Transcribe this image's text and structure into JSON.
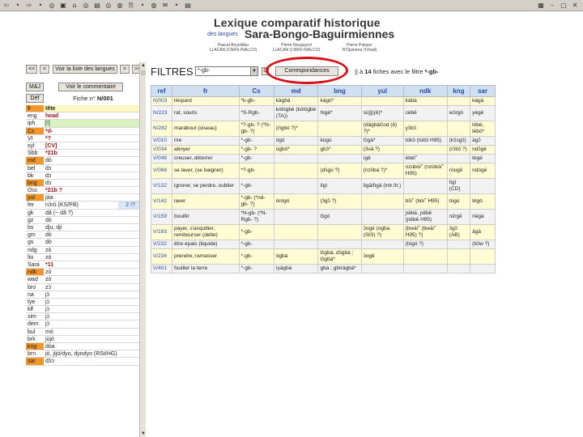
{
  "toolbar": {
    "left_glyphs": [
      "⇦",
      "•",
      "⇨",
      "•",
      "◎",
      "▣",
      "⌂",
      "◎",
      "▤",
      "◎",
      "◍",
      "⎘",
      "•",
      "◍",
      "✉",
      "•",
      "▤"
    ],
    "right_glyphs": [
      "▦",
      "–",
      "▢",
      "✕"
    ]
  },
  "header": {
    "title_line1": "Lexique comparatif historique",
    "title_prefix": "des langues",
    "title_line2": "Sara-Bongo-Baguirmiennes",
    "authors": [
      {
        "name": "Pascal Boyeldieu",
        "affil": "LLACAN (CNRS-INALCO)"
      },
      {
        "name": "Pierre Nougayrol",
        "affil": "LLACAN (CNRS-INALCO)"
      },
      {
        "name": "Pierre Palayer",
        "affil": "N'Djamena (Tchad)"
      }
    ]
  },
  "left": {
    "nav": {
      "first": "<<",
      "prev": "<",
      "list": "Voir la liste des langues",
      "next": ">",
      "last": ">>"
    },
    "msj": "M&J",
    "comment_btn": "Voir le commentaire",
    "def": "Déf",
    "fiche_label": "Fiche n°",
    "fiche_num": "N/001",
    "rows": [
      {
        "code": "fr",
        "value": "tête",
        "style": "orange yellow bold"
      },
      {
        "code": "eng",
        "value": "head",
        "style": "redtxt"
      },
      {
        "code": "iph",
        "value": "[!]",
        "style": "green"
      },
      {
        "code": "Cs",
        "value": "*d-",
        "style": "orange redtxt"
      },
      {
        "code": "VI",
        "value": "*?",
        "style": "redtxt"
      },
      {
        "code": "syl",
        "value": "[CV]",
        "style": "redtxt"
      },
      {
        "code": "Sbb",
        "value": "*21b",
        "style": "redtxt"
      },
      {
        "code": "md",
        "value": "dò",
        "style": "orange"
      },
      {
        "code": "bel",
        "value": "dɔ",
        "style": ""
      },
      {
        "code": "bk",
        "value": "dɔ",
        "style": ""
      },
      {
        "code": "bng",
        "value": "dɔ",
        "style": "orange"
      },
      {
        "code": "Occ",
        "value": "*21b ?",
        "style": "redtxt"
      },
      {
        "code": "yul",
        "value": "jàa",
        "style": "orange"
      },
      {
        "code": "fer",
        "value": "nɔ̀rū (KS/PB)",
        "extra": "2 !?",
        "style": ""
      },
      {
        "code": "gk",
        "value": "dǎ (~ dǎ ?)",
        "style": ""
      },
      {
        "code": "gz",
        "value": "dò",
        "style": ""
      },
      {
        "code": "bs",
        "value": "dju, dji",
        "style": ""
      },
      {
        "code": "gm",
        "value": "dò",
        "style": ""
      },
      {
        "code": "gs",
        "value": "dò",
        "style": ""
      },
      {
        "code": "ndg",
        "value": "zò",
        "style": ""
      },
      {
        "code": "lto",
        "value": "zò",
        "style": ""
      },
      {
        "code": "Sara",
        "value": "*11",
        "style": "redtxt"
      },
      {
        "code": "ndk",
        "value": "zò",
        "style": "orange"
      },
      {
        "code": "wad",
        "value": "zò",
        "style": ""
      },
      {
        "code": "bro",
        "value": "zɔ̀",
        "style": ""
      },
      {
        "code": "na",
        "value": "jɔ̀",
        "style": ""
      },
      {
        "code": "tye",
        "value": "jɔ̀",
        "style": ""
      },
      {
        "code": "klf",
        "value": "jɔ̀",
        "style": ""
      },
      {
        "code": "sim",
        "value": "jɔ̀",
        "style": ""
      },
      {
        "code": "dem",
        "value": "jɔ̀",
        "style": ""
      },
      {
        "code": "bul",
        "value": "mó",
        "style": ""
      },
      {
        "code": "brk",
        "value": "jùjó",
        "style": ""
      },
      {
        "code": "kng",
        "value": "dòa",
        "style": "orange"
      },
      {
        "code": "brn",
        "value": "jò, jìjò/dyo, dyodyo (RSt/HG)",
        "style": ""
      },
      {
        "code": "sar",
        "value": "dɔ̀ɔ",
        "style": "orange"
      }
    ]
  },
  "filter": {
    "label": "FILTRES",
    "select_value": "*-gb-",
    "small_btn": "D",
    "corr_btn": "Correspondances",
    "info_sep": "||",
    "info_prefix": "à",
    "info_count": "14",
    "info_mid": "fiches avec le filtre",
    "info_filter": "*-gb-"
  },
  "table": {
    "headers": [
      "ref",
      "fr",
      "Cs",
      "md",
      "bng",
      "yul",
      "ndk",
      "kng",
      "sar"
    ],
    "rows": [
      [
        "N/003",
        "léopard",
        "*k-gb-",
        "kàgbà",
        "kàgò*",
        "",
        "kàbà",
        "",
        "kàgà"
      ],
      [
        "N/223",
        "rat, souris",
        "*S-Rgb-",
        "kólógbè (kólógbè (TA))",
        "hìgé*",
        "sì(ǧ)(ê)*",
        "cèbē",
        "wɔ̄rgò",
        "yègě"
      ],
      [
        "N/282",
        "marabout (oiseau)",
        "*?-gb- ? (*N-gb- ?)",
        "(rìgbó ?)*",
        "",
        "(dǎgbàlɔ̀ɔd (ê) ?)*",
        "yɔ̀bɔ̀",
        "",
        "lòbé, lèbò*"
      ],
      [
        "V/010",
        "rire",
        "*-gb-",
        "ógó",
        "kúgú",
        "tɔ̀gá*",
        "tùbɔ̄ (tùbɔ̄ H95)",
        "(kɔ̀ɔgɔ̄)",
        "àgɔ̄"
      ],
      [
        "V/034",
        "aboyer",
        "*-gb- ?",
        "úgbó*",
        "gbɔ̄*",
        "(3vā ?)",
        "",
        "(rɔ̄bɔ̄ ?)",
        "ndɔ̄gě"
      ],
      [
        "V/049",
        "creuser, déterrer",
        "*-gb-",
        "",
        "",
        "ìgě",
        "èbé/˜",
        "",
        "tègé"
      ],
      [
        "V/068",
        "se laver, (se baigner)",
        "*?-gb-",
        "",
        "(dɔ̀gú ?)",
        "(nzìibá ?)*",
        "nzùbò/˜ (nzùbó/˜ H95)",
        "ròogō",
        "ndògē"
      ],
      [
        "V/132",
        "ignorer, se perdre, oublier",
        "*-gb-",
        "",
        "lìgì",
        "lìgǎ/lìgǎ (intr./tr.)",
        "",
        "lìgī (CD)",
        ""
      ],
      [
        "V/142",
        "laver",
        "*-gb- (*nd-gb- ?)",
        "ùrògó",
        "(ɔ̄gɔ̄ ?)",
        "",
        "bɔ̄/˜ (bó/˜ H95)",
        "tùgú",
        "tègó"
      ],
      [
        "V/159",
        "bouillir",
        "*N-gb- (*N-Rgb- ?)",
        "",
        "lɔ̀gò",
        "",
        "ɲēbē, ɲēbē (ɲēbē H95)",
        "nɛ̄rgē",
        "nēgá"
      ],
      [
        "V/193",
        "payer, s'acquitter, rembourser (dette)",
        "*-gb-",
        "",
        "",
        "ɔ̀ogé (ogba (StS) ?)",
        "(bwà/˜ (bwǎ/˜ H95) ?)",
        "ɔ̄gɔ̄ (AB)",
        "āgā"
      ],
      [
        "V/232",
        "être épais (liquide)",
        "*-gb-",
        "",
        "",
        "",
        "(tògó ?)",
        "",
        "(bɔ̄w ?)"
      ],
      [
        "V/234",
        "prendre, ramasser",
        "*-gb-",
        "ògbá",
        "tɔ̀gbá, dɔ̀gbá ; tɔ̀gbá*",
        "ɔ̀ogě",
        "",
        "",
        ""
      ],
      [
        "V/401",
        "fouiller la terre",
        "*-gb-",
        "ìyágbá",
        "gbá ; gbìrágbá*",
        "",
        "",
        "",
        ""
      ]
    ]
  }
}
